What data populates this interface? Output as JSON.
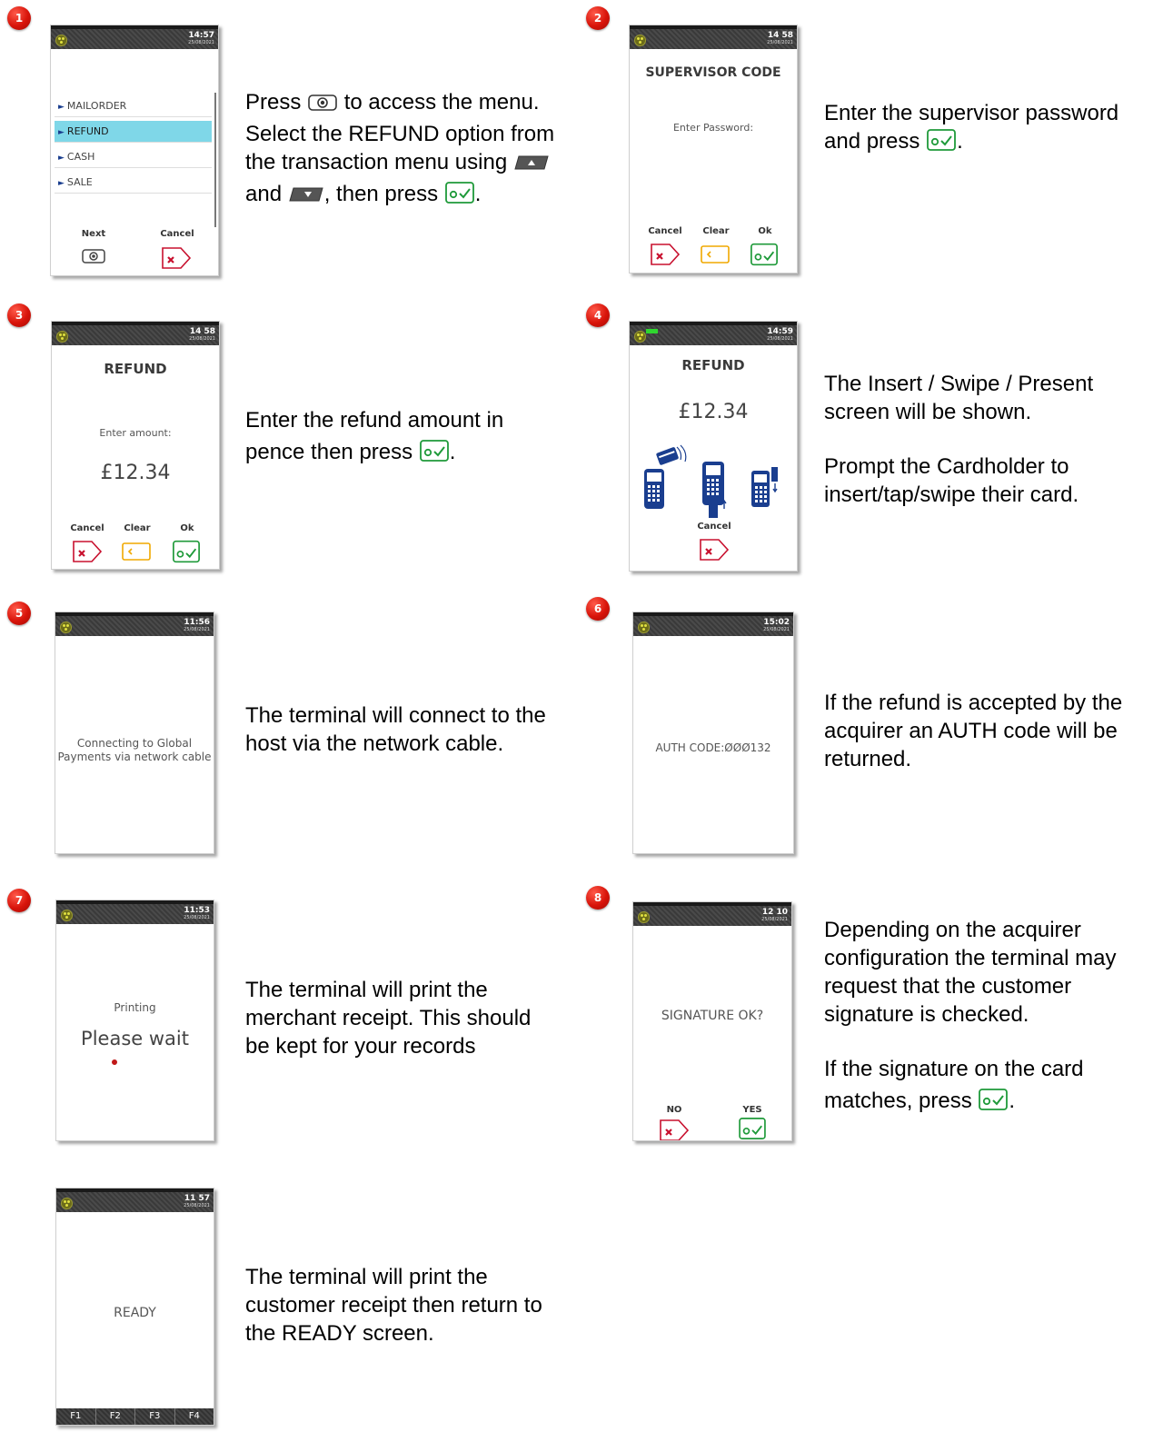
{
  "steps": [
    {
      "number": "1"
    },
    {
      "number": "2"
    },
    {
      "number": "3"
    },
    {
      "number": "4"
    },
    {
      "number": "5"
    },
    {
      "number": "6"
    },
    {
      "number": "7"
    },
    {
      "number": "8"
    }
  ],
  "screens": {
    "s1": {
      "time": "14:57",
      "date": "25/08/2021",
      "menu": [
        "MAILORDER",
        "REFUND",
        "CASH",
        "SALE"
      ],
      "next_label": "Next",
      "cancel_label": "Cancel"
    },
    "s2": {
      "time": "14 58",
      "date": "25/08/2021",
      "title": "SUPERVISOR CODE",
      "prompt": "Enter Password:",
      "cancel_label": "Cancel",
      "clear_label": "Clear",
      "ok_label": "Ok"
    },
    "s3": {
      "time": "14 58",
      "date": "25/08/2021",
      "title": "REFUND",
      "prompt": "Enter amount:",
      "amount": "£12.34",
      "cancel_label": "Cancel",
      "clear_label": "Clear",
      "ok_label": "Ok"
    },
    "s4": {
      "time": "14:59",
      "date": "25/08/2021",
      "title": "REFUND",
      "amount": "£12.34",
      "cancel_label": "Cancel"
    },
    "s5": {
      "time": "11:56",
      "date": "25/08/2021",
      "line1": "Connecting to Global",
      "line2": "Payments via network cable"
    },
    "s6": {
      "time": "15:02",
      "date": "25/08/2021",
      "message": "AUTH CODE:ØØØ132"
    },
    "s7": {
      "time": "11:53",
      "date": "25/08/2021",
      "small": "Printing",
      "large": "Please wait"
    },
    "s8": {
      "time": "12 10",
      "date": "25/08/2021",
      "message": "SIGNATURE OK?",
      "no_label": "NO",
      "yes_label": "YES"
    },
    "s9": {
      "time": "11 57",
      "date": "25/08/2021",
      "message": "READY",
      "fkeys": [
        "F1",
        "F2",
        "F3",
        "F4"
      ]
    }
  },
  "instructions": {
    "i1": {
      "a": "Press",
      "b": "to access the menu.",
      "c": "Select the REFUND option from",
      "d": "the transaction menu using",
      "e": "and",
      "f": ", then press",
      "g": "."
    },
    "i2": {
      "a": "Enter the supervisor password",
      "b": "and press",
      "c": "."
    },
    "i3": {
      "a": "Enter the refund amount in",
      "b": "pence then press",
      "c": "."
    },
    "i4": {
      "a": "The Insert / Swipe / Present",
      "b": "screen will be shown.",
      "c": "Prompt the Cardholder to",
      "d": "insert/tap/swipe their card."
    },
    "i5": {
      "a": "The terminal will connect to the",
      "b": "host via the network cable."
    },
    "i6": {
      "a": "If the refund is accepted by the",
      "b": "acquirer an AUTH code will be",
      "c": "returned."
    },
    "i7": {
      "a": "The terminal will print the",
      "b": "merchant receipt. This should",
      "c": "be kept for your records"
    },
    "i8": {
      "a": "Depending on the acquirer",
      "b": "configuration the terminal may",
      "c": "request that the customer",
      "d": "signature is checked.",
      "e": "If the signature on the card",
      "f": "matches, press",
      "g": "."
    },
    "i9": {
      "a": "The terminal will print the",
      "b": "customer receipt then return to",
      "c": "the READY screen."
    }
  },
  "colors": {
    "badge": "#d8140a",
    "highlight": "#7fd7e8",
    "cancel": "#c8102e",
    "clear": "#f0a800",
    "ok": "#1f9a3a"
  }
}
